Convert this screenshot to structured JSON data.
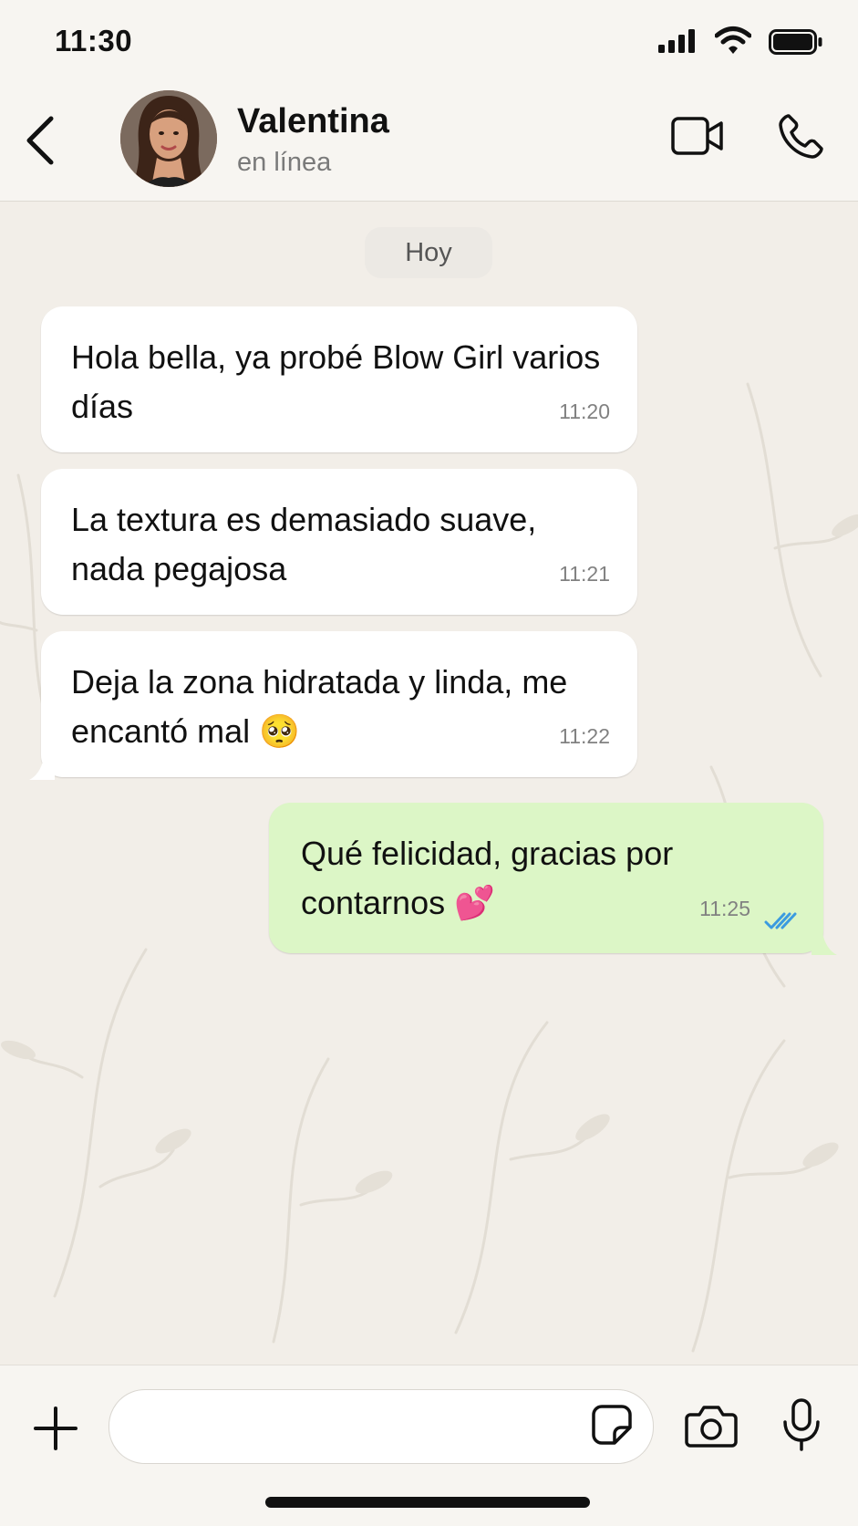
{
  "status_bar": {
    "time": "11:30"
  },
  "header": {
    "contact_name": "Valentina",
    "contact_status": "en línea"
  },
  "chat": {
    "date_chip": "Hoy",
    "messages": [
      {
        "direction": "incoming",
        "text": "Hola bella, ya probé Blow Girl varios días",
        "time": "11:20"
      },
      {
        "direction": "incoming",
        "text": "La textura es demasiado suave, nada pegajosa",
        "time": "11:21"
      },
      {
        "direction": "incoming",
        "text": "Deja la zona hidratada y linda, me encantó mal 🥺",
        "time": "11:22"
      },
      {
        "direction": "outgoing",
        "text": "Qué felicidad, gracias por contarnos 💕",
        "time": "11:25",
        "read": true
      }
    ]
  },
  "input_bar": {
    "value": "",
    "placeholder": ""
  },
  "colors": {
    "incoming_bubble": "#ffffff",
    "outgoing_bubble": "#dcf6c6",
    "read_ticks": "#3b9be0",
    "chat_background": "#f2eee8"
  },
  "icons": [
    "back-icon",
    "video-call-icon",
    "phone-icon",
    "plus-icon",
    "sticker-icon",
    "camera-icon",
    "microphone-icon",
    "double-check-icon",
    "signal-icon",
    "wifi-icon",
    "battery-icon"
  ]
}
